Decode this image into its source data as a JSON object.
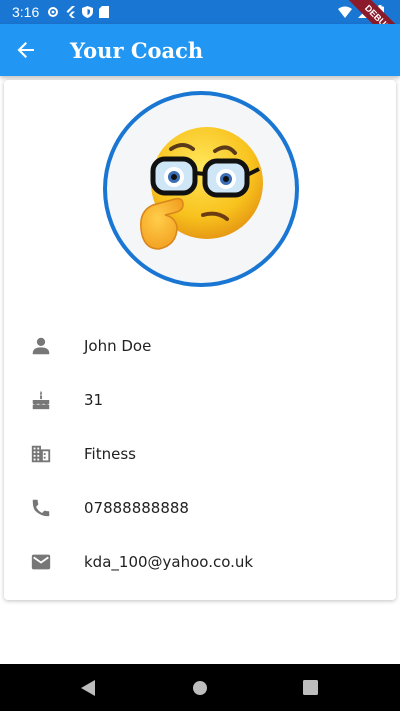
{
  "status_bar": {
    "time": "3:16",
    "debug_label": "DEBUG",
    "left_icons": [
      "gear-icon",
      "flutter-icon",
      "shield-icon",
      "sd-card-icon"
    ],
    "right_icons": [
      "wifi-icon",
      "signal-icon",
      "battery-icon"
    ]
  },
  "app_bar": {
    "title": "Your Coach",
    "back_icon": "arrow-back-icon",
    "background": "#2196f3"
  },
  "profile": {
    "avatar_icon": "thinking-emoji-with-glasses",
    "ring_color": "#1976d2",
    "fields": [
      {
        "icon": "person-icon",
        "value": "John Doe"
      },
      {
        "icon": "cake-icon",
        "value": "31"
      },
      {
        "icon": "business-icon",
        "value": "Fitness"
      },
      {
        "icon": "phone-icon",
        "value": "07888888888"
      },
      {
        "icon": "email-icon",
        "value": "kda_100@yahoo.co.uk"
      }
    ]
  },
  "nav_bar": {
    "icons": [
      "nav-back-icon",
      "nav-home-icon",
      "nav-recent-icon"
    ]
  }
}
